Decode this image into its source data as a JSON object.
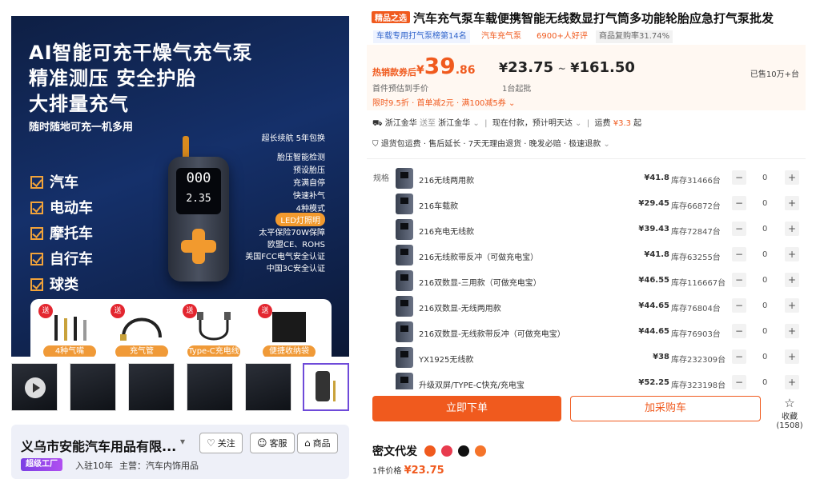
{
  "hero": {
    "title_lines": [
      "AI智能可充干燥气充气泵",
      "精准测压 安全护胎",
      "大排量充气"
    ],
    "subtitle": "随时随地可充一机多用",
    "features": [
      "汽车",
      "电动车",
      "摩托车",
      "自行车",
      "球类"
    ],
    "specs": [
      "超长续航 5年包换",
      "胎压智能检测",
      "预设胎压",
      "充满自停",
      "快速补气",
      "4种模式",
      "LED灯照明",
      "太平保险70W保障",
      "欧盟CE、ROHS",
      "美国FCC电气安全认证",
      "中国3C安全认证"
    ],
    "device_readout_top": "000",
    "device_readout_bottom": "2.35",
    "accessories": [
      {
        "badge": "送",
        "label": "4种气嘴"
      },
      {
        "badge": "送",
        "label": "充气管"
      },
      {
        "badge": "送",
        "label": "Type-C充电线"
      },
      {
        "badge": "送",
        "label": "便捷收纳袋"
      }
    ]
  },
  "thumbnails": [
    {
      "type": "video"
    },
    {
      "type": "image"
    },
    {
      "type": "image"
    },
    {
      "type": "image"
    },
    {
      "type": "image"
    },
    {
      "type": "image",
      "selected": true
    }
  ],
  "shop": {
    "name": "义乌市安能汽车用品有限...",
    "buttons": {
      "follow": "关注",
      "service": "客服",
      "products": "商品"
    },
    "badge": "超级工厂",
    "years": "入驻10年",
    "main_business": "主营：汽车内饰用品"
  },
  "product": {
    "title_tag": "精品之选",
    "title": "汽车充气泵车载便携智能无线数显打气筒多功能轮胎应急打气泵批发",
    "tags": [
      "车载专用打气泵榜第14名",
      "汽车充气泵",
      "6900+人好评",
      "商品复购率31.74%"
    ],
    "price": {
      "label": "热销款券后",
      "symbol": "¥",
      "integer": "39",
      "decimal": ".86",
      "note": "首件预估到手价",
      "range_low": "23.75",
      "range_high": "161.50",
      "min_order": "1台起批",
      "sold": "已售10万+台"
    },
    "promo": "限时9.5折 · 首单减2元 · 满100减5券",
    "shipping": {
      "from": "浙江金华",
      "arrow": "送至",
      "to": "浙江金华",
      "delivery": "现在付款，预计明天达",
      "fee_label": "运费",
      "fee": "¥3.3",
      "fee_suffix": "起"
    },
    "services": "退货包运费 · 售后延长 · 7天无理由退货 · 晚发必赔 · 极速退款",
    "spec_label": "规格",
    "skus": [
      {
        "name": "216无线两用款",
        "price": "¥41.8",
        "stock": "库存31466台",
        "qty": "0"
      },
      {
        "name": "216车载款",
        "price": "¥29.45",
        "stock": "库存66872台",
        "qty": "0"
      },
      {
        "name": "216充电无线款",
        "price": "¥39.43",
        "stock": "库存72847台",
        "qty": "0"
      },
      {
        "name": "216无线款带反冲（可做充电宝）",
        "price": "¥41.8",
        "stock": "库存63255台",
        "qty": "0"
      },
      {
        "name": "216双数显-三用款（可做充电宝）",
        "price": "¥46.55",
        "stock": "库存116667台",
        "qty": "0"
      },
      {
        "name": "216双数显-无线两用款",
        "price": "¥44.65",
        "stock": "库存76804台",
        "qty": "0"
      },
      {
        "name": "216双数显-无线款带反冲（可做充电宝）",
        "price": "¥44.65",
        "stock": "库存76903台",
        "qty": "0"
      },
      {
        "name": "YX1925无线款",
        "price": "¥38",
        "stock": "库存232309台",
        "qty": "0"
      },
      {
        "name": "升级双屏/TYPE-C快充/充电宝",
        "price": "¥52.25",
        "stock": "库存323198台",
        "qty": "0"
      }
    ],
    "actions": {
      "order": "立即下单",
      "cart": "加采购车",
      "favorite": "收藏 (1508)"
    },
    "miwen": {
      "title": "密文代发",
      "price_label": "1件价格",
      "price": "¥23.75"
    }
  },
  "colors": {
    "accent": "#f05a1e",
    "shop_badge": "#7b3fe4"
  }
}
